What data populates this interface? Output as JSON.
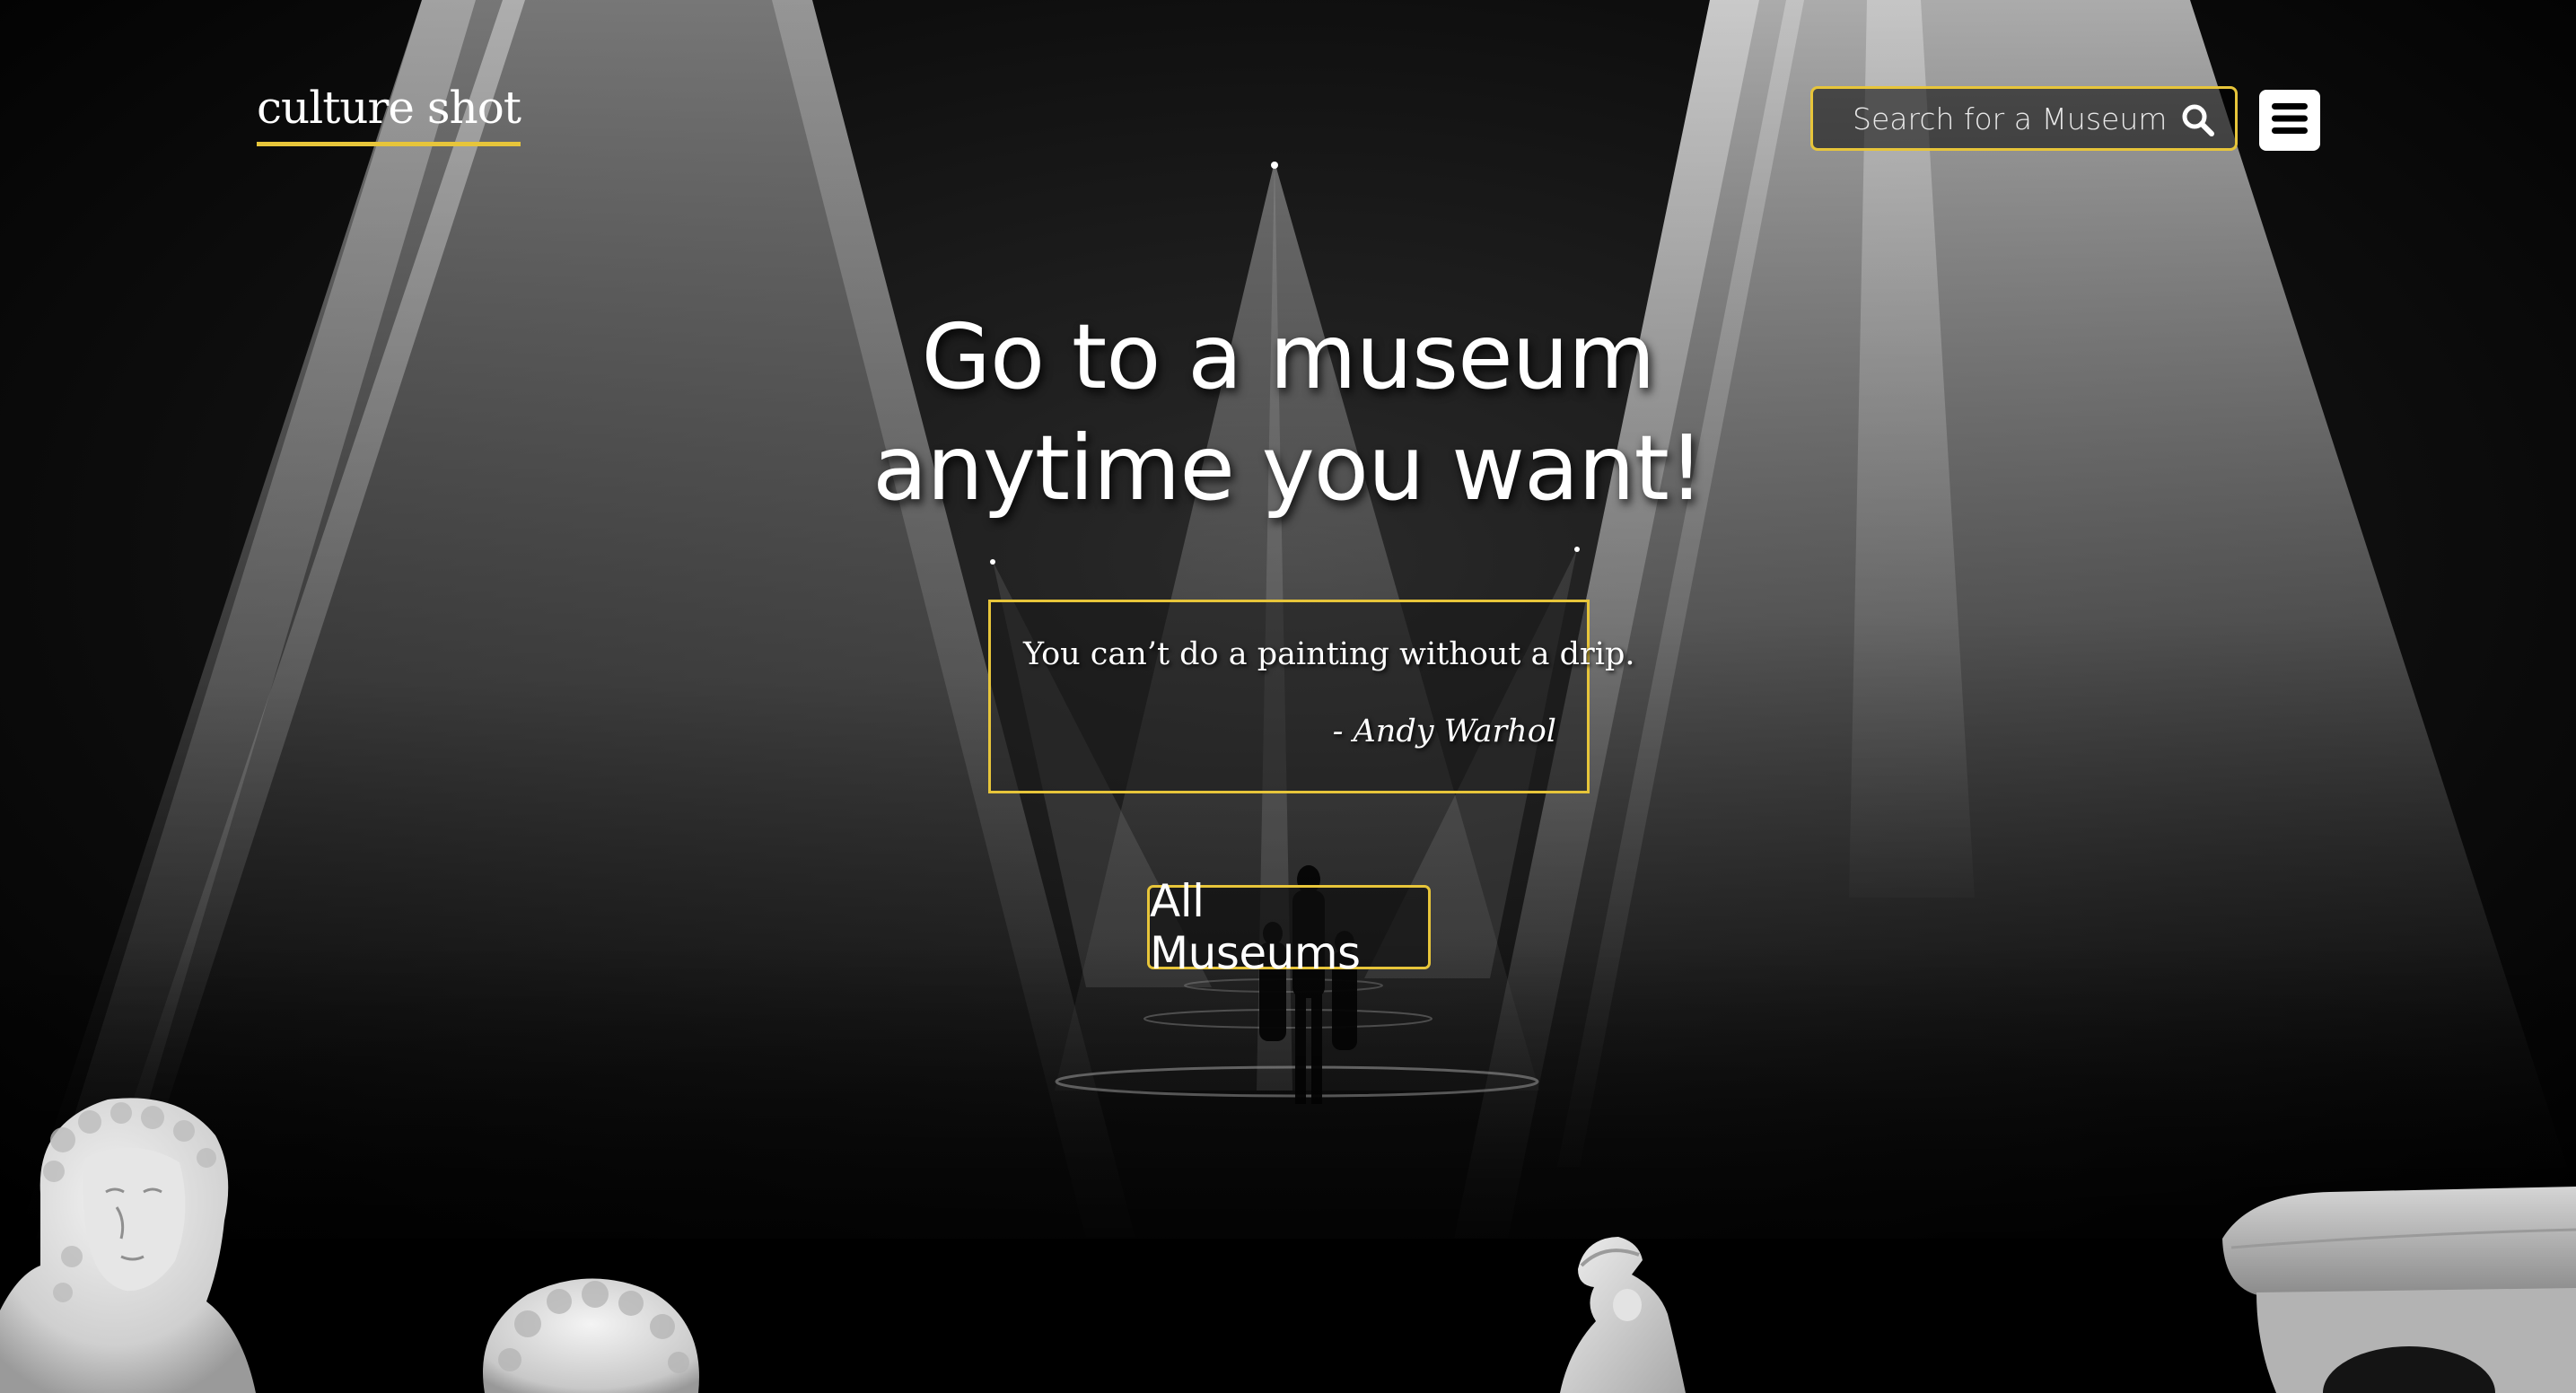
{
  "header": {
    "logo_text": "culture shot",
    "search_placeholder": "Search for a Museum",
    "search_icon": "search-icon",
    "menu_icon": "hamburger-menu-icon"
  },
  "hero": {
    "headline_line1": "Go to a museum",
    "headline_line2": "anytime you want!",
    "quote": "You can’t do a painting without a drip.",
    "quote_author": "- Andy Warhol",
    "cta_label": "All Museums"
  },
  "colors": {
    "accent": "#e7c53a",
    "background": "#000000",
    "text": "#ffffff"
  }
}
